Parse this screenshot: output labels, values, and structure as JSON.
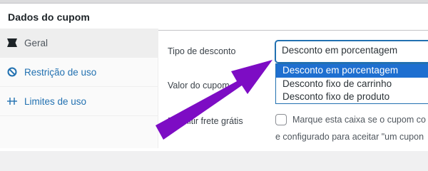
{
  "metabox": {
    "title": "Dados do cupom"
  },
  "tabs": [
    {
      "label": "Geral",
      "icon": "ticket-icon"
    },
    {
      "label": "Restrição de uso",
      "icon": "ban-icon"
    },
    {
      "label": "Limites de uso",
      "icon": "limits-icon"
    }
  ],
  "fields": {
    "discount_type_label": "Tipo de desconto",
    "discount_type_value": "Desconto em porcentagem",
    "coupon_value_label": "Valor do cupom",
    "free_shipping_label": "Permitir frete grátis",
    "free_shipping_text": "Marque esta caixa se o cupom co",
    "free_shipping_text2": "e configurado para aceitar \"um cupon"
  },
  "dropdown_options": [
    "Desconto em porcentagem",
    "Desconto fixo de carrinho",
    "Desconto fixo de produto"
  ],
  "colors": {
    "accent": "#2271b1",
    "selected_option": "#1e6fd0",
    "annotation_arrow": "#7d0cc4"
  }
}
